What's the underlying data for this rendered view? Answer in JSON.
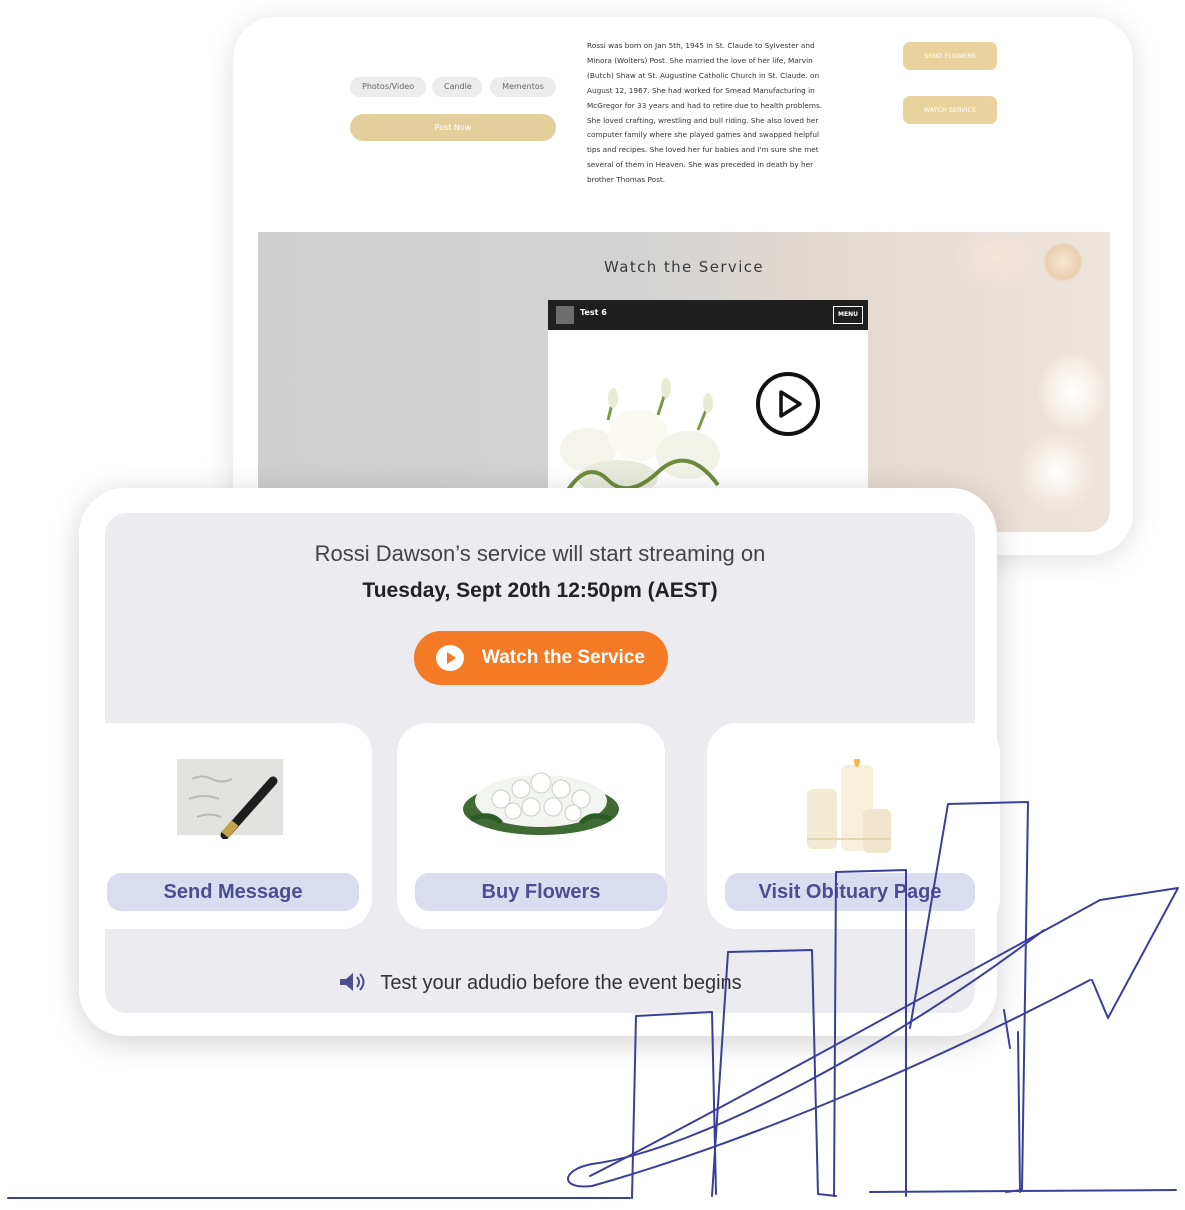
{
  "obituary": {
    "tabs": [
      "Photos/Video",
      "Candle",
      "Mementos"
    ],
    "post_button": "Post Now",
    "bio": "Rossi was born on Jan 5th, 1945 in St. Claude to Sylvester and Minora (Wolters) Post. She married the love of her life, Marvin (Butch) Shaw at St. Augustine Catholic Church in St. Claude. on August 12, 1967. She had worked for Smead Manufacturing in McGregor for 33 years and had to retire due to health problems. She loved crafting, wrestling and bull riding. She also loved her computer family where she played games and swapped helpful tips and recipes. She loved her fur babies and I'm sure she met several of them in Heaven. She was preceded in death by her brother Thomas Post.",
    "send_flowers_button": "SEND FLOWERS",
    "watch_service_button": "WATCH SERVICE",
    "service_heading": "Watch the Service",
    "video": {
      "title": "Test 6",
      "menu_label": "MENU"
    }
  },
  "stream": {
    "announcement": "Rossi Dawson’s service will start streaming on",
    "datetime": "Tuesday, Sept 20th 12:50pm (AEST)",
    "watch_button": "Watch the Service",
    "actions": [
      {
        "label": "Send Message",
        "image": "pen-on-paper"
      },
      {
        "label": "Buy Flowers",
        "image": "white-flower-arrangement"
      },
      {
        "label": "Visit Obituary Page",
        "image": "candles"
      }
    ],
    "audio_note": "Test your adudio before the event begins",
    "audio_icon": "speaker-icon"
  },
  "colors": {
    "accent_orange": "#f57a26",
    "gold": "#e2cf9c",
    "lavender": "#dadcf0",
    "label_text": "#4d4e92",
    "doodle_blue": "#3b3f9a"
  }
}
